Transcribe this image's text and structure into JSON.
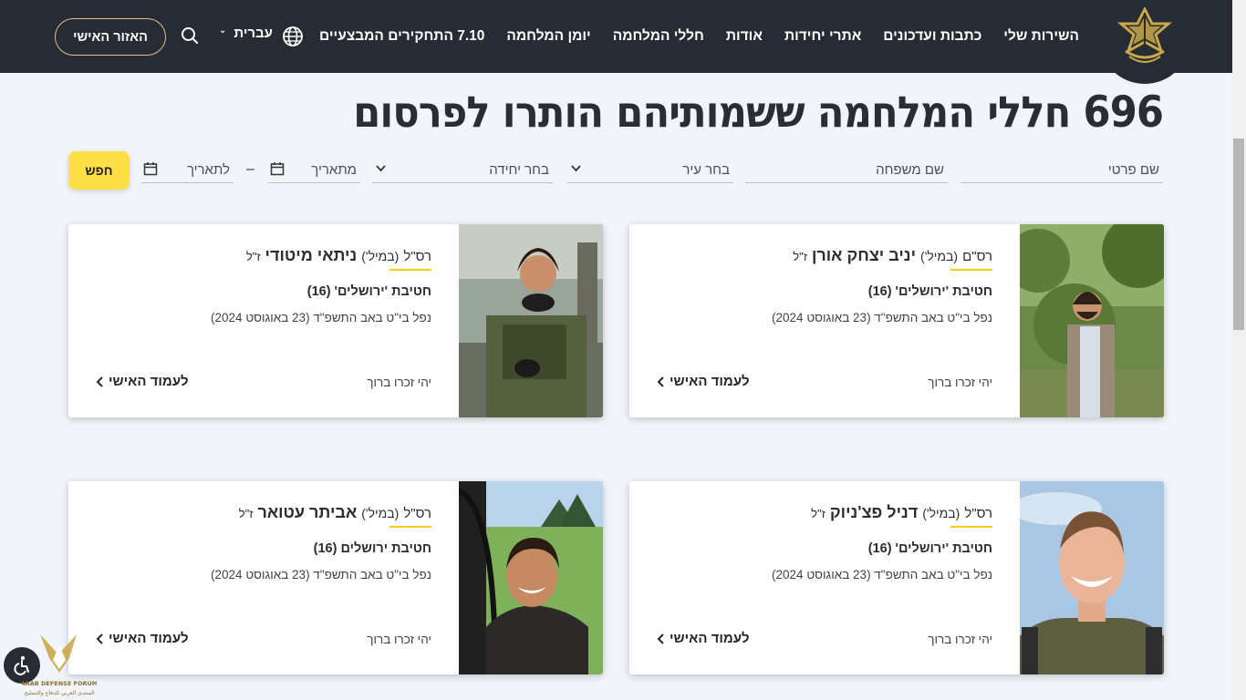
{
  "nav": {
    "items": [
      "השירות שלי",
      "כתבות ועדכונים",
      "אתרי יחידות",
      "אודות",
      "חללי המלחמה",
      "יומן המלחמה",
      "7.10 התחקירים המבצעיים"
    ],
    "language": "עברית",
    "personal_area": "האזור האישי"
  },
  "page": {
    "title": "696 חללי המלחמה ששמותיהם הותרו לפרסום"
  },
  "filters": {
    "first_name": "שם פרטי",
    "last_name": "שם משפחה",
    "city": "בחר עיר",
    "unit": "בחר יחידה",
    "from_date": "מתאריך",
    "to_date": "לתאריך",
    "dash": "–",
    "search_button": "חפש"
  },
  "cards": [
    {
      "rank": "רס\"ם",
      "reserve": "(במיל')",
      "name": "יניב יצחק אורן",
      "suffix": "ז\"ל",
      "unit": "חטיבת 'ירושלים' (16)",
      "fell": "נפל בי\"ט באב התשפ\"ד (23 באוגוסט 2024)",
      "memory": "יהי זכרו ברוך",
      "link": "לעמוד האישי"
    },
    {
      "rank": "רס\"ל",
      "reserve": "(במיל')",
      "name": "ניתאי מיטודי",
      "suffix": "ז\"ל",
      "unit": "חטיבת 'ירושלים' (16)",
      "fell": "נפל בי\"ט באב התשפ\"ד (23 באוגוסט 2024)",
      "memory": "יהי זכרו ברוך",
      "link": "לעמוד האישי"
    },
    {
      "rank": "רס\"ל",
      "reserve": "(במיל')",
      "name": "דניל פצ'ניוק",
      "suffix": "ז\"ל",
      "unit": "חטיבת 'ירושלים' (16)",
      "fell": "נפל בי\"ט באב התשפ\"ד (23 באוגוסט 2024)",
      "memory": "יהי זכרו ברוך",
      "link": "לעמוד האישי"
    },
    {
      "rank": "רס\"ל",
      "reserve": "(במיל')",
      "name": "אביתר עטואר",
      "suffix": "ז\"ל",
      "unit": "חטיבת ירושלים (16)",
      "fell": "נפל בי\"ט באב התשפ\"ד (23 באוגוסט 2024)",
      "memory": "יהי זכרו ברוך",
      "link": "לעמוד האישי"
    }
  ],
  "watermark": {
    "line1": "ARAB DEFENSE FORUM",
    "line2": "المنتدى العربي للدفاع والتسليح"
  },
  "colors": {
    "header_bg": "#272b33",
    "accent_yellow": "#fde047",
    "underline_yellow": "#facc15",
    "page_bg": "#f1f5f9"
  }
}
